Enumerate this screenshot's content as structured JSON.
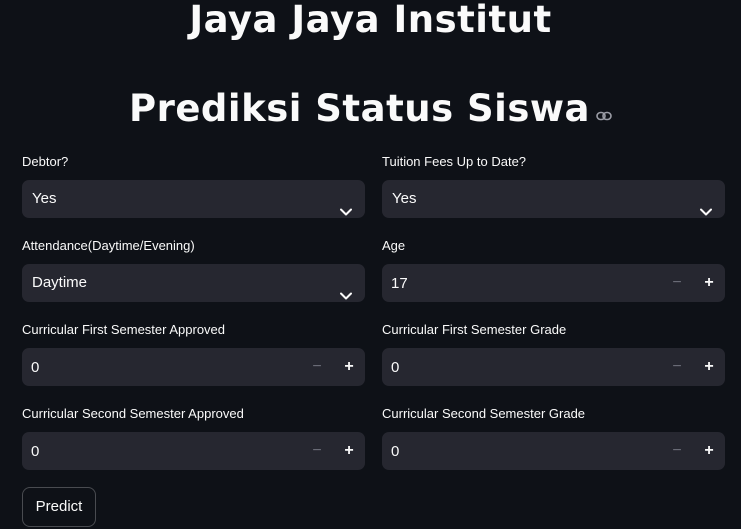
{
  "header": {
    "title": "Jaya Jaya Institut",
    "subtitle": "Prediksi Status Siswa",
    "anchor_icon": "link-icon"
  },
  "form": {
    "debtor": {
      "label": "Debtor?",
      "value": "Yes"
    },
    "tuition": {
      "label": "Tuition Fees Up to Date?",
      "value": "Yes"
    },
    "attendance": {
      "label": "Attendance(Daytime/Evening)",
      "value": "Daytime"
    },
    "age": {
      "label": "Age",
      "value": "17"
    },
    "cur1_approved": {
      "label": "Curricular First Semester Approved",
      "value": "0"
    },
    "cur1_grade": {
      "label": "Curricular First Semester Grade",
      "value": "0"
    },
    "cur2_approved": {
      "label": "Curricular Second Semester Approved",
      "value": "0"
    },
    "cur2_grade": {
      "label": "Curricular Second Semester Grade",
      "value": "0"
    },
    "stepper_minus": "−",
    "stepper_plus": "+"
  },
  "actions": {
    "predict_label": "Predict"
  },
  "colors": {
    "background": "#0e1117",
    "widget": "#262730",
    "text": "#fafafa",
    "muted": "#6b6d78"
  }
}
